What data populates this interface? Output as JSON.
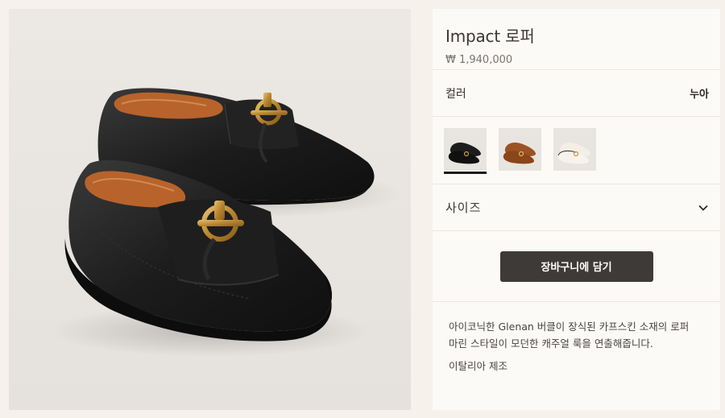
{
  "product": {
    "name": "Impact 로퍼",
    "price": "₩ 1,940,000",
    "image_alt": "Black leather loafers with gold Glenan buckle"
  },
  "color": {
    "label": "컬러",
    "selected": "누아",
    "swatches": [
      {
        "name": "black",
        "color": "#1d1d1d"
      },
      {
        "name": "tan",
        "color": "#9c5324"
      },
      {
        "name": "white",
        "color": "#f0ebe1"
      }
    ]
  },
  "size": {
    "label": "사이즈"
  },
  "cart": {
    "button_label": "장바구니에 담기"
  },
  "description": {
    "line1": "아이코닉한 Glenan 버클이 장식된 카프스킨 소재의 로퍼",
    "line2": "마린 스타일이 모던한 캐주얼 룩을 연출해줍니다.",
    "origin": "이탈리아 제조"
  }
}
